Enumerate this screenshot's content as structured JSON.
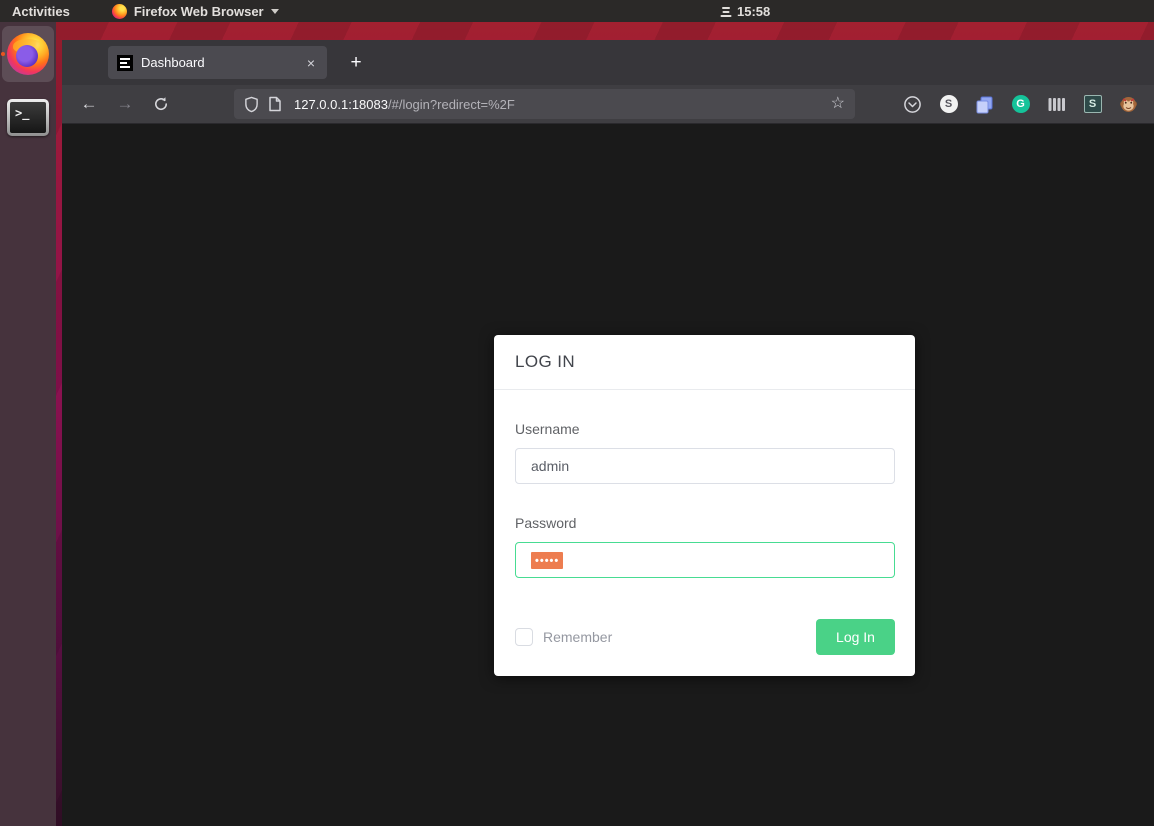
{
  "desktop": {
    "top_bar": {
      "activities_label": "Activities",
      "app_menu_label": "Firefox Web Browser",
      "clock_time": "15:58"
    },
    "dock": {
      "terminal_prompt_glyph": ">_"
    }
  },
  "browser": {
    "tabs": [
      {
        "title": "Dashboard",
        "close_glyph": "×"
      }
    ],
    "new_tab_glyph": "+",
    "nav": {
      "back_glyph": "←",
      "forward_glyph": "→"
    },
    "address": {
      "host": "127.0.0.1:18083",
      "path": "/#/login?redirect=%2F",
      "bookmark_star_glyph": "☆"
    },
    "extensions": {
      "shortkeys_letter": "S",
      "grammarly_letter": "G",
      "stylus_letter": "S"
    }
  },
  "page": {
    "login_card": {
      "title": "LOG IN",
      "username_label": "Username",
      "username_value": "admin",
      "password_label": "Password",
      "password_masked_value": "•••••",
      "remember_label": "Remember",
      "login_button_label": "Log In"
    }
  },
  "colors": {
    "accent_button_green": "#4ad287",
    "focused_input_border_green": "#47dc92",
    "password_selection_orange": "#ed7d50",
    "ubuntu_orange": "#e95420",
    "page_background": "#1a1a1a"
  }
}
